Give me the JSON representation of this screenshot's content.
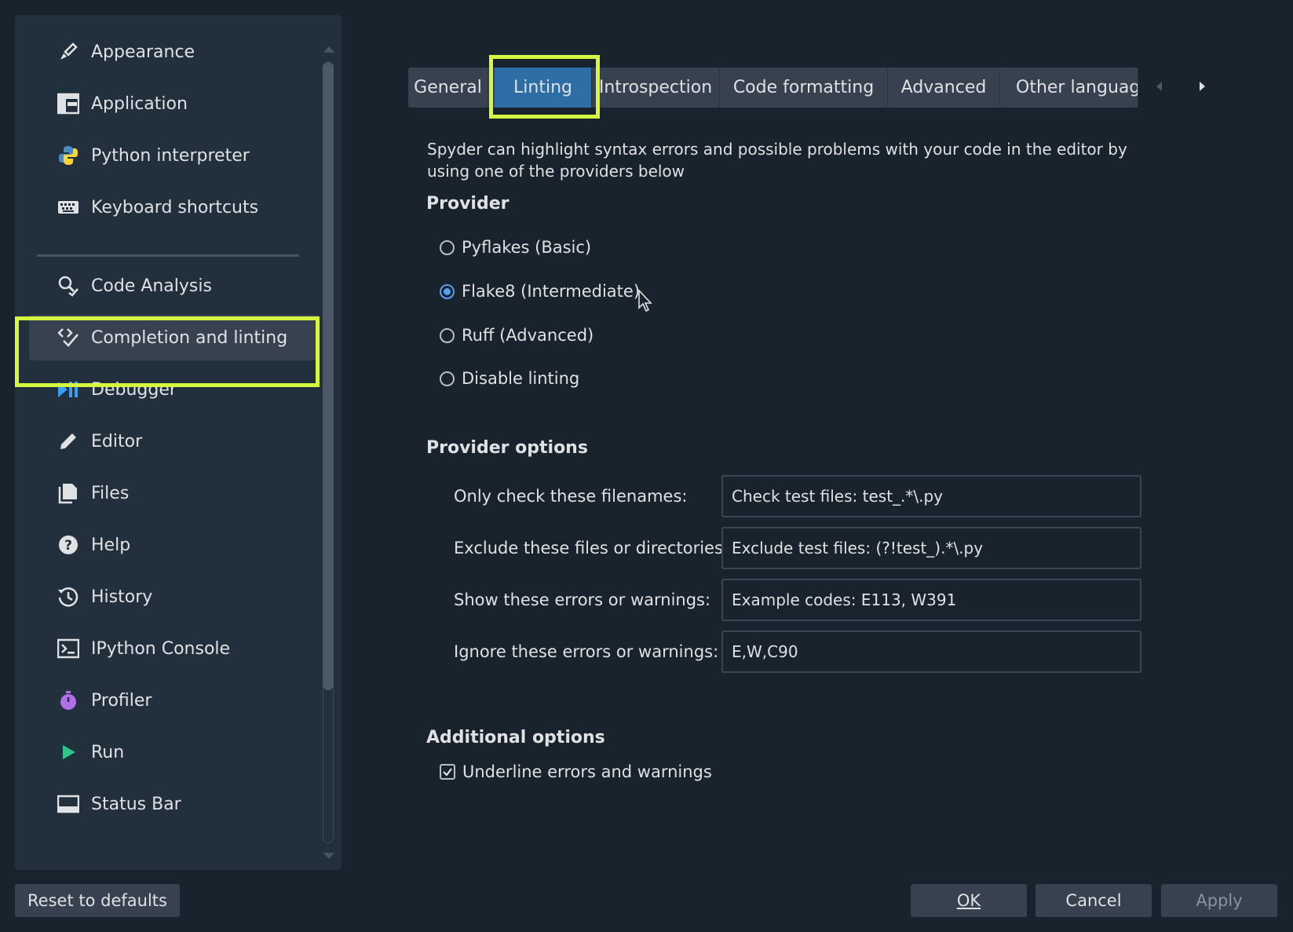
{
  "sidebar": {
    "items": [
      {
        "label": "Appearance",
        "icon": "paintbrush-icon"
      },
      {
        "label": "Application",
        "icon": "application-layout-icon"
      },
      {
        "label": "Python interpreter",
        "icon": "python-icon"
      },
      {
        "label": "Keyboard shortcuts",
        "icon": "keyboard-icon"
      },
      {
        "label": "Code Analysis",
        "icon": "code-analysis-icon"
      },
      {
        "label": "Completion and linting",
        "icon": "completion-icon",
        "selected": true
      },
      {
        "label": "Debugger",
        "icon": "debugger-icon"
      },
      {
        "label": "Editor",
        "icon": "pencil-icon"
      },
      {
        "label": "Files",
        "icon": "files-icon"
      },
      {
        "label": "Help",
        "icon": "help-icon"
      },
      {
        "label": "History",
        "icon": "history-icon"
      },
      {
        "label": "IPython Console",
        "icon": "console-icon"
      },
      {
        "label": "Profiler",
        "icon": "profiler-icon"
      },
      {
        "label": "Run",
        "icon": "run-icon"
      },
      {
        "label": "Status Bar",
        "icon": "status-bar-icon"
      }
    ]
  },
  "tabs": [
    {
      "label": "General"
    },
    {
      "label": "Linting",
      "active": true
    },
    {
      "label": "Introspection"
    },
    {
      "label": "Code formatting"
    },
    {
      "label": "Advanced"
    },
    {
      "label": "Other languag"
    }
  ],
  "linting": {
    "description": "Spyder can highlight syntax errors and possible problems with your code in the editor by using one of the providers below",
    "provider_title": "Provider",
    "providers": [
      {
        "label": "Pyflakes (Basic)",
        "checked": false
      },
      {
        "label": "Flake8 (Intermediate)",
        "checked": true
      },
      {
        "label": "Ruff (Advanced)",
        "checked": false
      },
      {
        "label": "Disable linting",
        "checked": false
      }
    ],
    "provider_options_title": "Provider options",
    "options": [
      {
        "label": "Only check these filenames:",
        "placeholder": "Check test files: test_.*\\.py",
        "value": ""
      },
      {
        "label": "Exclude these files or directories:",
        "placeholder": "Exclude test files: (?!test_).*\\.py",
        "value": ""
      },
      {
        "label": "Show these errors or warnings:",
        "placeholder": "Example codes: E113, W391",
        "value": ""
      },
      {
        "label": "Ignore these errors or warnings:",
        "placeholder": "",
        "value": "E,W,C90"
      }
    ],
    "additional_title": "Additional options",
    "underline_label": "Underline errors and warnings",
    "underline_checked": true
  },
  "buttons": {
    "reset": "Reset to defaults",
    "ok": "OK",
    "cancel": "Cancel",
    "apply": "Apply"
  },
  "colors": {
    "background": "#19232d",
    "panel": "#222f3c",
    "accent": "#2e6ea6",
    "highlight": "#d6f73f"
  }
}
